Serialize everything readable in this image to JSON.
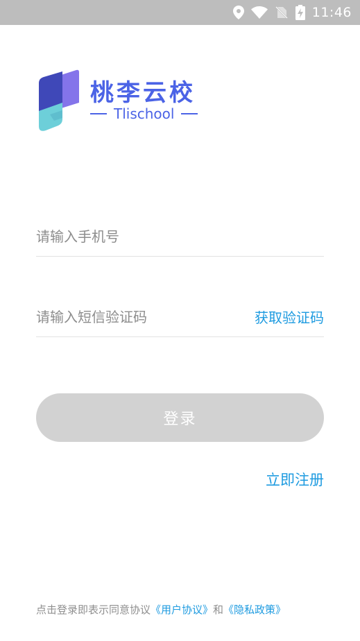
{
  "status_bar": {
    "time": "11:46",
    "icons": [
      "location-icon",
      "wifi-icon",
      "no-sim-icon",
      "battery-charging-icon"
    ]
  },
  "logo": {
    "title": "桃李云校",
    "subtitle": "Tlischool",
    "colors": {
      "brand": "#4b63e6",
      "purple": "#7b69e8",
      "indigo": "#3d45b5",
      "teal": "#6ad3dc"
    }
  },
  "form": {
    "phone_placeholder": "请输入手机号",
    "code_placeholder": "请输入短信验证码",
    "get_code_label": "获取验证码",
    "login_label": "登录",
    "register_label": "立即注册"
  },
  "agreement": {
    "prefix": "点击登录即表示同意协议",
    "user_agreement": "《用户协议》",
    "and": "和",
    "privacy_policy": "《隐私政策》"
  },
  "colors": {
    "accent": "#1e9be0",
    "button_disabled": "#d2d2d2",
    "status_bar": "#bdbdbd"
  }
}
